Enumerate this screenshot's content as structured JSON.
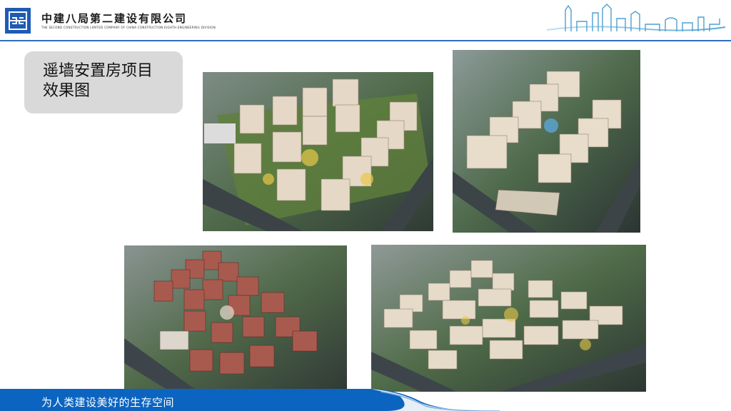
{
  "header": {
    "company_name": "中建八局第二建设有限公司",
    "company_name_en": "THE SECOND CONSTRUCTION LIMITED COMPANY OF CHINA CONSTRUCTION EIGHTH ENGINEERING DIVISION",
    "logo_icon": "cscec-logo-icon",
    "skyline_icon": "city-skyline-icon"
  },
  "title": {
    "line1": "遥墙安置房项目",
    "line2": "效果图"
  },
  "renderings": [
    {
      "icon": "aerial-rendering-image"
    },
    {
      "icon": "aerial-rendering-image"
    },
    {
      "icon": "aerial-rendering-image"
    },
    {
      "icon": "aerial-rendering-image"
    }
  ],
  "footer": {
    "slogan": "为人类建设美好的生存空间"
  },
  "colors": {
    "brand_blue": "#1f5bb5",
    "header_rule": "#2f6db8",
    "footer_blue": "#0b64c0",
    "title_box_bg": "#d9d9d9"
  }
}
